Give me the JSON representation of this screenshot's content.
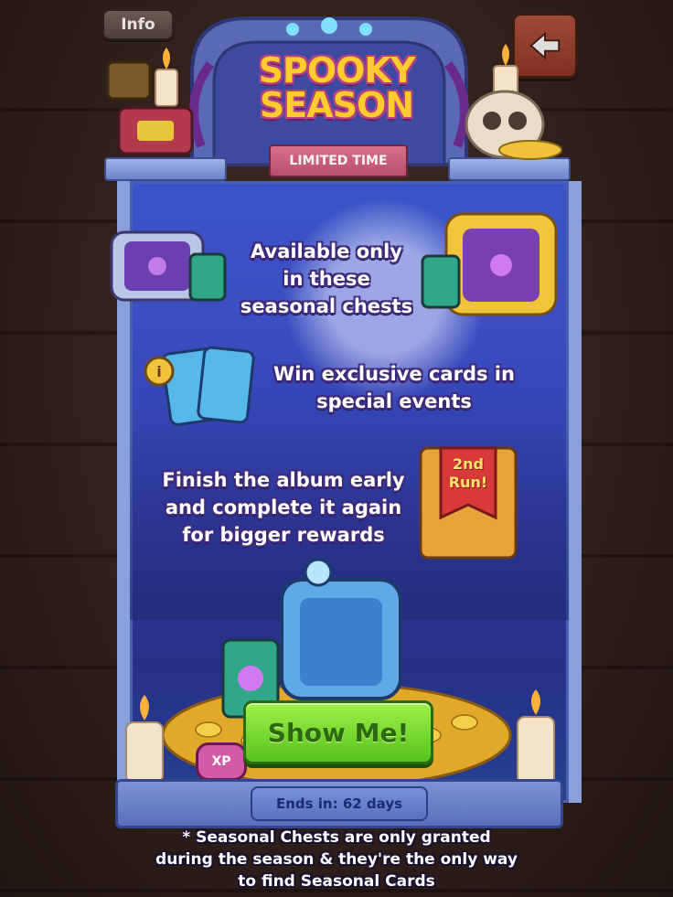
{
  "header": {
    "info_label": "Info",
    "title_line1": "SPOOKY",
    "title_line2": "SEASON",
    "ribbon": "LIMITED TIME",
    "back_icon": "arrow-left-icon"
  },
  "features": [
    {
      "text_lines": [
        "Available only",
        "in these",
        "seasonal chests"
      ]
    },
    {
      "text_lines": [
        "Win exclusive cards in",
        "special events"
      ]
    },
    {
      "text_lines": [
        "Finish the album early",
        "and complete it again",
        "for bigger rewards"
      ]
    }
  ],
  "book_label": [
    "2nd",
    "Run!"
  ],
  "xp_label": "XP",
  "cta": {
    "label": "Show Me!"
  },
  "ends": {
    "label": "Ends in: 62 days"
  },
  "footnote_lines": [
    "* Seasonal Chests are only granted",
    "during the season & they're the only way",
    "to find Seasonal Cards"
  ],
  "colors": {
    "title": "#ffcb2e",
    "cta": "#7bd832",
    "panel": "#3b4cc0",
    "ribbon": "#c75f7c"
  }
}
